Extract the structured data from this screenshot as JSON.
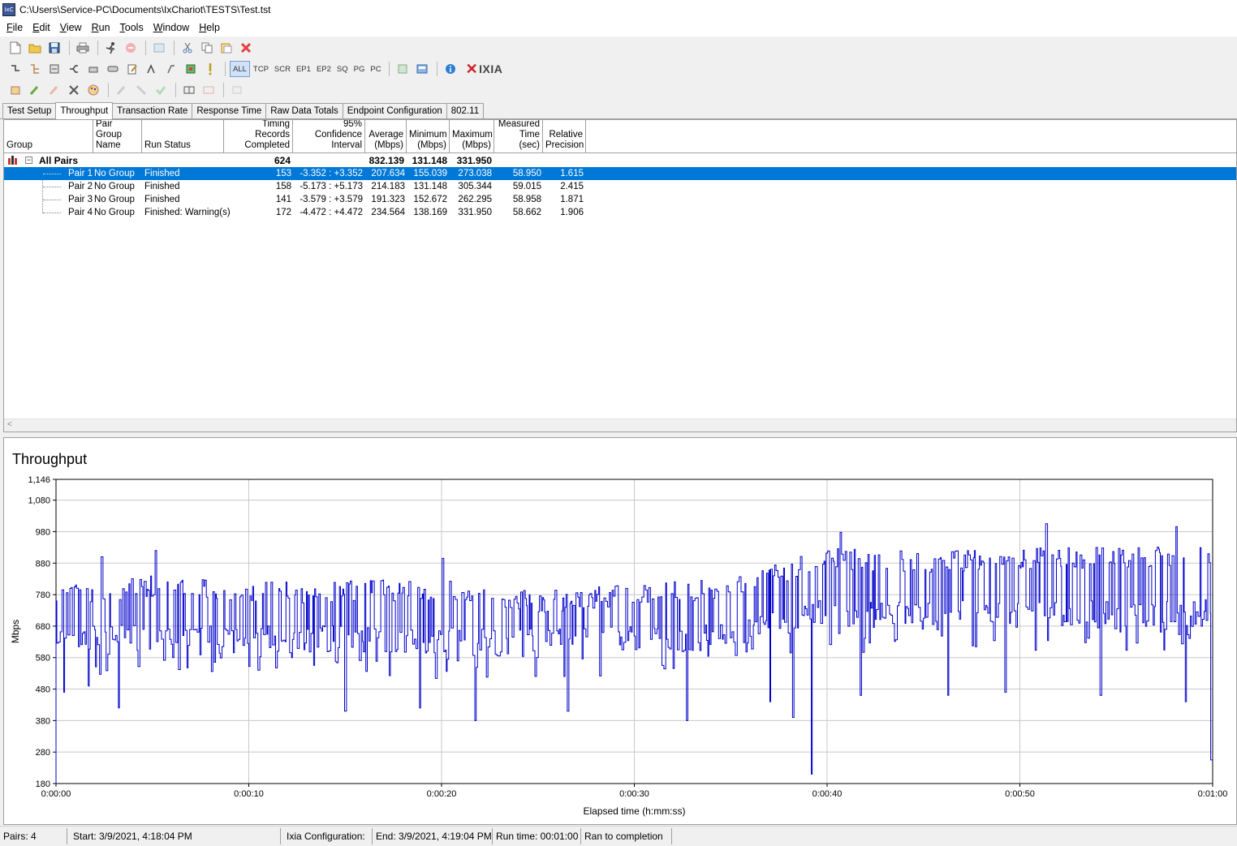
{
  "window": {
    "title": "C:\\Users\\Service-PC\\Documents\\IxChariot\\TESTS\\Test.tst",
    "app_icon_text": "IxC"
  },
  "menu": [
    {
      "label": "File",
      "key": "F",
      "rest": "ile"
    },
    {
      "label": "Edit",
      "key": "E",
      "rest": "dit"
    },
    {
      "label": "View",
      "key": "V",
      "rest": "iew"
    },
    {
      "label": "Run",
      "key": "R",
      "rest": "un"
    },
    {
      "label": "Tools",
      "key": "T",
      "rest": "ools"
    },
    {
      "label": "Window",
      "key": "W",
      "rest": "indow"
    },
    {
      "label": "Help",
      "key": "H",
      "rest": "elp"
    }
  ],
  "toolbar2": {
    "filters": [
      "ALL",
      "TCP",
      "SCR",
      "EP1",
      "EP2",
      "SQ",
      "PG",
      "PC"
    ],
    "active_filter": "ALL",
    "logo": "IXIA"
  },
  "tabs": [
    "Test Setup",
    "Throughput",
    "Transaction Rate",
    "Response Time",
    "Raw Data Totals",
    "Endpoint Configuration",
    "802.11"
  ],
  "active_tab": "Throughput",
  "grid": {
    "headers": {
      "group": "Group",
      "pair_group_name": "Pair Group\nName",
      "run_status": "Run Status",
      "timing_records": "Timing Records\nCompleted",
      "confidence": "95% Confidence\nInterval",
      "average": "Average\n(Mbps)",
      "minimum": "Minimum\n(Mbps)",
      "maximum": "Maximum\n(Mbps)",
      "measured_time": "Measured\nTime (sec)",
      "relative_precision": "Relative\nPrecision"
    },
    "all_pairs": {
      "label": "All Pairs",
      "expander": "−",
      "records": "624",
      "average": "832.139",
      "minimum": "131.148",
      "maximum": "331.950"
    },
    "rows": [
      {
        "pair": "Pair 1",
        "group": "No Group",
        "status": "Finished",
        "records": "153",
        "confidence": "-3.352 : +3.352",
        "average": "207.634",
        "minimum": "155.039",
        "maximum": "273.038",
        "time": "58.950",
        "precision": "1.615",
        "selected": true
      },
      {
        "pair": "Pair 2",
        "group": "No Group",
        "status": "Finished",
        "records": "158",
        "confidence": "-5.173 : +5.173",
        "average": "214.183",
        "minimum": "131.148",
        "maximum": "305.344",
        "time": "59.015",
        "precision": "2.415",
        "selected": false
      },
      {
        "pair": "Pair 3",
        "group": "No Group",
        "status": "Finished",
        "records": "141",
        "confidence": "-3.579 : +3.579",
        "average": "191.323",
        "minimum": "152.672",
        "maximum": "262.295",
        "time": "58.958",
        "precision": "1.871",
        "selected": false
      },
      {
        "pair": "Pair 4",
        "group": "No Group",
        "status": "Finished: Warning(s)",
        "records": "172",
        "confidence": "-4.472 : +4.472",
        "average": "234.564",
        "minimum": "138.169",
        "maximum": "331.950",
        "time": "58.662",
        "precision": "1.906",
        "selected": false
      }
    ],
    "scroll_arrow": "<"
  },
  "chart_data": {
    "type": "line",
    "title": "Throughput",
    "xlabel": "Elapsed time (h:mm:ss)",
    "ylabel": "Mbps",
    "ylim": [
      180,
      1146
    ],
    "xlim_seconds": [
      0,
      60
    ],
    "y_ticks": [
      "180",
      "280",
      "380",
      "480",
      "580",
      "680",
      "780",
      "880",
      "980",
      "1,080",
      "1,146"
    ],
    "x_ticks": [
      "0:00:00",
      "0:00:10",
      "0:00:20",
      "0:00:30",
      "0:00:40",
      "0:00:50",
      "0:01:00"
    ],
    "grid": true,
    "series": [
      {
        "color": "#0000cc",
        "profile": [
          {
            "t": 0,
            "high": 820,
            "low": 600
          },
          {
            "t": 5,
            "high": 840,
            "low": 600
          },
          {
            "t": 10,
            "high": 820,
            "low": 590
          },
          {
            "t": 15,
            "high": 825,
            "low": 600
          },
          {
            "t": 20,
            "high": 830,
            "low": 590
          },
          {
            "t": 25,
            "high": 790,
            "low": 580
          },
          {
            "t": 30,
            "high": 815,
            "low": 590
          },
          {
            "t": 35,
            "high": 830,
            "low": 600
          },
          {
            "t": 40,
            "high": 930,
            "low": 680
          },
          {
            "t": 45,
            "high": 920,
            "low": 670
          },
          {
            "t": 50,
            "high": 930,
            "low": 680
          },
          {
            "t": 55,
            "high": 935,
            "low": 670
          },
          {
            "t": 60,
            "high": 930,
            "low": 680
          }
        ],
        "dips": [
          {
            "t": 0.45,
            "v": 470
          },
          {
            "t": 1.7,
            "v": 490
          },
          {
            "t": 3.2,
            "v": 420
          },
          {
            "t": 6.0,
            "v": 580
          },
          {
            "t": 10.5,
            "v": 540
          },
          {
            "t": 11.8,
            "v": 420
          },
          {
            "t": 15.0,
            "v": 410
          },
          {
            "t": 18.8,
            "v": 420
          },
          {
            "t": 21.7,
            "v": 380
          },
          {
            "t": 24.8,
            "v": 350
          },
          {
            "t": 26.5,
            "v": 410
          },
          {
            "t": 29.6,
            "v": 440
          },
          {
            "t": 32.7,
            "v": 380
          },
          {
            "t": 37.0,
            "v": 440
          },
          {
            "t": 38.2,
            "v": 390
          },
          {
            "t": 39.2,
            "v": 210
          },
          {
            "t": 41.7,
            "v": 460
          },
          {
            "t": 46.3,
            "v": 460
          },
          {
            "t": 49.2,
            "v": 470
          },
          {
            "t": 51.4,
            "v": 330
          },
          {
            "t": 54.2,
            "v": 460
          },
          {
            "t": 58.6,
            "v": 440
          },
          {
            "t": 59.9,
            "v": 250
          }
        ],
        "peaks": [
          {
            "t": 2.3,
            "v": 900
          },
          {
            "t": 5.1,
            "v": 920
          },
          {
            "t": 20.0,
            "v": 895
          },
          {
            "t": 40.7,
            "v": 978
          },
          {
            "t": 51.3,
            "v": 1005
          },
          {
            "t": 58.1,
            "v": 996
          },
          {
            "t": 59.3,
            "v": 988
          }
        ],
        "end_values": {
          "start": 760,
          "finish": 255
        }
      }
    ]
  },
  "status_bar": {
    "pairs": "Pairs: 4",
    "start": "Start: 3/9/2021, 4:18:04 PM",
    "ixia_config": "Ixia Configuration:",
    "end": "End: 3/9/2021, 4:19:04 PM",
    "run_time": "Run time: 00:01:00",
    "completion": "Ran to completion"
  }
}
